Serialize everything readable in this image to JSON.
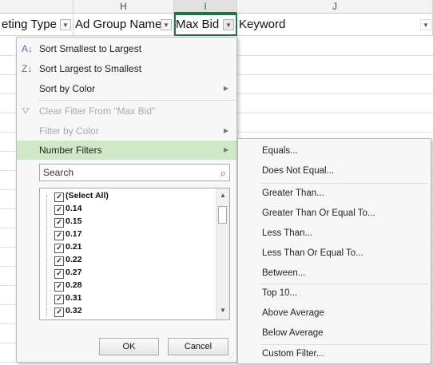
{
  "sheet": {
    "column_letters": {
      "h": "H",
      "i": "I",
      "j": "J"
    },
    "headers": {
      "targeting_type": "eting Type",
      "ad_group_name": "Ad Group Name",
      "max_bid": "Max Bid",
      "keyword": "Keyword"
    }
  },
  "filter_menu": {
    "sort_smallest": "Sort Smallest to Largest",
    "sort_largest": "Sort Largest to Smallest",
    "sort_by_color": "Sort by Color",
    "clear_filter": "Clear Filter From \"Max Bid\"",
    "filter_by_color": "Filter by Color",
    "number_filters": "Number Filters",
    "search_placeholder": "Search",
    "values": [
      {
        "label": "(Select All)",
        "checked": true
      },
      {
        "label": "0.14",
        "checked": true
      },
      {
        "label": "0.15",
        "checked": true
      },
      {
        "label": "0.17",
        "checked": true
      },
      {
        "label": "0.21",
        "checked": true
      },
      {
        "label": "0.22",
        "checked": true
      },
      {
        "label": "0.27",
        "checked": true
      },
      {
        "label": "0.28",
        "checked": true
      },
      {
        "label": "0.31",
        "checked": true
      },
      {
        "label": "0.32",
        "checked": true
      }
    ],
    "ok_label": "OK",
    "cancel_label": "Cancel"
  },
  "number_filters_submenu": {
    "equals": "Equals...",
    "does_not_equal": "Does Not Equal...",
    "greater_than": "Greater Than...",
    "greater_than_or_equal": "Greater Than Or Equal To...",
    "less_than": "Less Than...",
    "less_than_or_equal": "Less Than Or Equal To...",
    "between": "Between...",
    "top_10": "Top 10...",
    "above_average": "Above Average",
    "below_average": "Below Average",
    "custom_filter": "Custom Filter..."
  },
  "colors": {
    "excel_green": "#217346",
    "highlight": "#cfe9c7",
    "accent_blue": "#2b5fa8"
  },
  "icons": [
    "sort-ascending-icon",
    "sort-descending-icon",
    "clear-filter-icon",
    "search-icon",
    "dropdown-arrow-icon",
    "submenu-arrow-icon",
    "checkbox-icon"
  ]
}
